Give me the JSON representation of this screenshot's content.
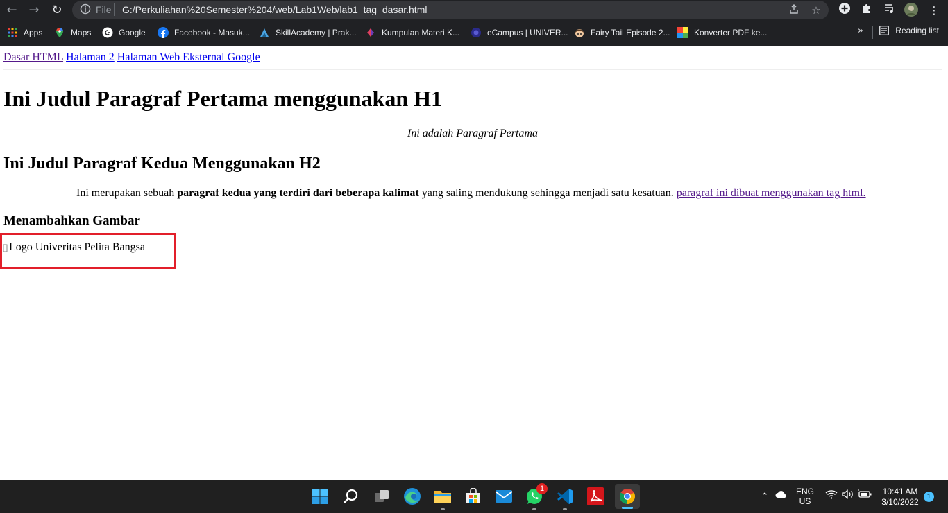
{
  "browser": {
    "url_scheme": "File",
    "url": "G:/Perkuliahan%20Semester%204/web/Lab1Web/lab1_tag_dasar.html",
    "bookmarks": [
      {
        "label": "Apps",
        "icon": "apps-grid-icon",
        "color": "#ea4335"
      },
      {
        "label": "Maps",
        "icon": "maps-pin-icon",
        "color": "#34a853"
      },
      {
        "label": "Google",
        "icon": "google-g-icon",
        "color": "#ffffff"
      },
      {
        "label": "Facebook - Masuk...",
        "icon": "facebook-icon",
        "color": "#1877f2"
      },
      {
        "label": "SkillAcademy | Prak...",
        "icon": "skillacademy-icon",
        "color": "#4aa3df"
      },
      {
        "label": "Kumpulan Materi K...",
        "icon": "kumpulan-materi-icon",
        "color": "#e04060"
      },
      {
        "label": "eCampus | UNIVER...",
        "icon": "ecampus-icon",
        "color": "#2a2a8a"
      },
      {
        "label": "Fairy Tail Episode 2...",
        "icon": "fairy-tail-icon",
        "color": "#c07a3a"
      },
      {
        "label": "Konverter PDF ke...",
        "icon": "konverter-pdf-icon",
        "color": "#ff9800"
      }
    ],
    "bookmarks_more": "»",
    "reading_list": "Reading list"
  },
  "page": {
    "nav_links": [
      "Dasar HTML",
      "Halaman 2",
      "Halaman Web Eksternal Google"
    ],
    "h1": "Ini Judul Paragraf Pertama menggunakan H1",
    "p1": "Ini adalah Paragraf Pertama",
    "h2": "Ini Judul Paragraf Kedua Menggunakan H2",
    "p2_start": "Ini merupakan sebuah ",
    "p2_bold": "paragraf kedua yang terdiri dari beberapa kalimat",
    "p2_mid": " yang saling mendukung sehingga menjadi satu kesatuan. ",
    "p2_link": "paragraf ini dibuat menggunakan tag html.",
    "h3": "Menambahkan Gambar",
    "img_alt": "Logo Univeritas Pelita Bangsa",
    "highlight_color": "#e21f2a"
  },
  "taskbar": {
    "whatsapp_badge": "1",
    "lang_top": "ENG",
    "lang_bottom": "US",
    "time": "10:41 AM",
    "date": "3/10/2022",
    "notification_count": "1"
  }
}
